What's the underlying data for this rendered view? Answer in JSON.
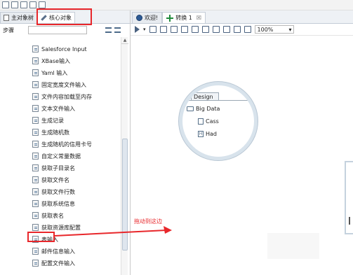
{
  "top_toolbar": {
    "icons": [
      "new-file-icon",
      "open-folder-icon",
      "explore-icon",
      "save-icon",
      "save-as-icon"
    ]
  },
  "left_panel": {
    "tabs": [
      {
        "label": "主对象树",
        "icon": "document-icon"
      },
      {
        "label": "核心对象",
        "icon": "pen-icon"
      }
    ],
    "step_label": "步骤",
    "search_placeholder": "",
    "items": [
      {
        "label": "Salesforce Input"
      },
      {
        "label": "XBase输入"
      },
      {
        "label": "Yaml 输入"
      },
      {
        "label": "固定宽度文件输入"
      },
      {
        "label": "文件内容加载至内存"
      },
      {
        "label": "文本文件输入"
      },
      {
        "label": "生成记录"
      },
      {
        "label": "生成随机数"
      },
      {
        "label": "生成随机的信用卡号"
      },
      {
        "label": "自定义常量数据"
      },
      {
        "label": "获取子目录名"
      },
      {
        "label": "获取文件名"
      },
      {
        "label": "获取文件行数"
      },
      {
        "label": "获取系统信息"
      },
      {
        "label": "获取表名"
      },
      {
        "label": "获取资源库配置"
      },
      {
        "label": "表输入"
      },
      {
        "label": "邮件信息输入"
      },
      {
        "label": "配置文件输入"
      }
    ]
  },
  "right_panel": {
    "tabs": [
      {
        "label": "欢迎!",
        "icon": "welcome-circle-icon"
      },
      {
        "label": "转换 1",
        "icon": "transformation-icon",
        "close": "☒"
      }
    ],
    "zoom": "100%"
  },
  "lens": {
    "tab": "Design",
    "rows": [
      "Big Data",
      "Cass",
      "Had"
    ]
  },
  "annotation": {
    "text": "拖动到这边",
    "color": "#e8272b"
  }
}
